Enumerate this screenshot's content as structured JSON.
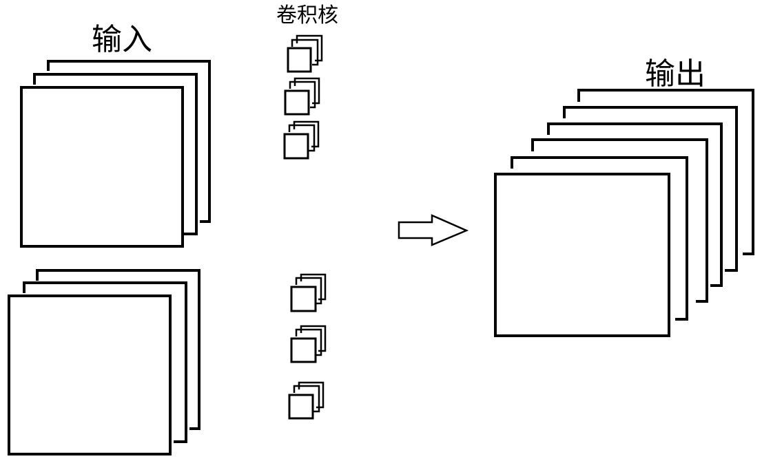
{
  "labels": {
    "input": "输入",
    "kernels": "卷积核",
    "output": "输出"
  },
  "groups": {
    "input_stack_top": {
      "layers": 3
    },
    "input_stack_bottom": {
      "layers": 3
    },
    "kernel_stacks_top": {
      "count": 3,
      "layers_each": 3
    },
    "kernel_stacks_bottom": {
      "count": 3,
      "layers_each": 3
    },
    "output_stack": {
      "layers": 6
    }
  },
  "arrow": {
    "direction": "right"
  },
  "colors": {
    "stroke": "#000000",
    "fill": "#ffffff"
  }
}
